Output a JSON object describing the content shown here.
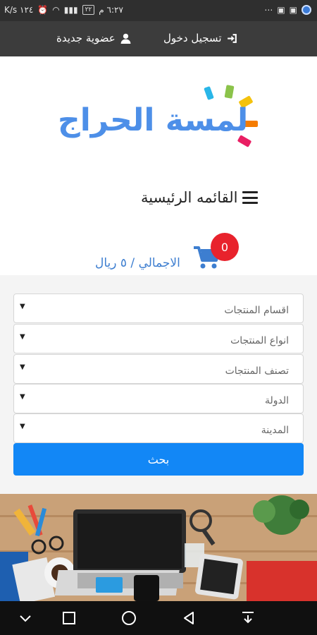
{
  "status_bar": {
    "time": "٦:٢٧ م",
    "battery": "٢٢",
    "speed": "١٢٤ K/s"
  },
  "auth": {
    "login_label": "تسجيل دخول",
    "register_label": "عضوية جديدة"
  },
  "logo": {
    "text": "لمسة الحراج"
  },
  "menu": {
    "label": "القائمه الرئيسية"
  },
  "cart": {
    "count": "0",
    "total_label": "الاجمالي / ٥ ريال"
  },
  "filters": {
    "categories": "اقسام المنتجات",
    "types": "انواع المنتجات",
    "classification": "تصنف المنتجات",
    "country": "الدولة",
    "city": "المدينة"
  },
  "search_button": "بحث",
  "colors": {
    "accent": "#1287f6",
    "badge": "#e8222c",
    "logo_blue": "#4d8fe8",
    "header_dark": "#3c3c3c"
  }
}
